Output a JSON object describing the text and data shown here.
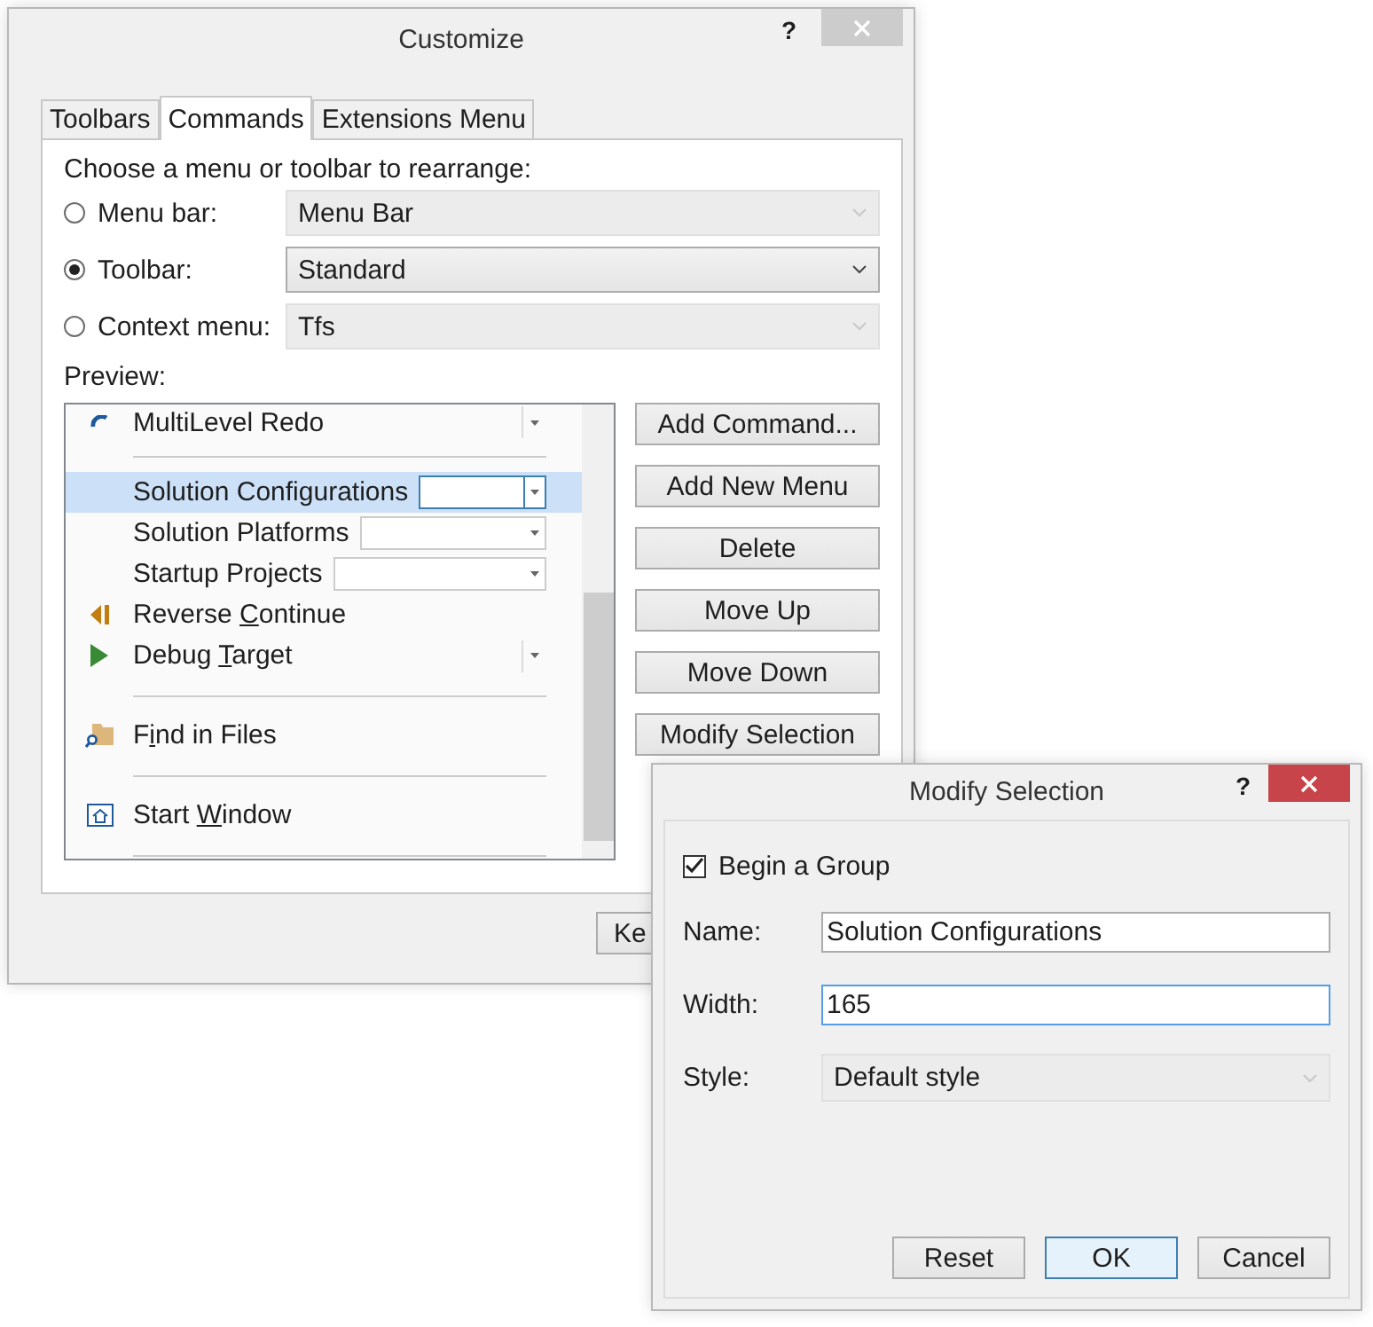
{
  "customize": {
    "title": "Customize",
    "help": "?",
    "tabs": [
      {
        "label": "Toolbars",
        "selected": false
      },
      {
        "label": "Commands",
        "selected": true
      },
      {
        "label": "Extensions Menu",
        "selected": false
      }
    ],
    "prompt": "Choose a menu or toolbar to rearrange:",
    "targets": [
      {
        "label": "Menu bar:",
        "selected": false,
        "value": "Menu Bar",
        "disabled": true
      },
      {
        "label": "Toolbar:",
        "selected": true,
        "value": "Standard",
        "disabled": false
      },
      {
        "label": "Context menu:",
        "selected": false,
        "value": "Tfs",
        "disabled": true
      }
    ],
    "preview_label": "Preview:",
    "preview_items": [
      {
        "kind": "command",
        "before": "MultiLevel Redo",
        "selected": false,
        "dropdown": true
      },
      {
        "kind": "separator"
      },
      {
        "kind": "combo",
        "before": "Solution Configurations",
        "selected": true
      },
      {
        "kind": "combo",
        "before": "Solution Platforms",
        "selected": false
      },
      {
        "kind": "combo",
        "before": "Startup Projects",
        "selected": false
      },
      {
        "kind": "command",
        "before": "Reverse ",
        "key": "C",
        "after": "ontinue",
        "selected": false,
        "dropdown": false
      },
      {
        "kind": "command",
        "before": "Debug ",
        "key": "T",
        "after": "arget",
        "selected": false,
        "dropdown": true
      },
      {
        "kind": "separator"
      },
      {
        "kind": "command",
        "before": "F",
        "key": "i",
        "after": "nd in Files",
        "selected": false,
        "dropdown": false
      },
      {
        "kind": "separator"
      },
      {
        "kind": "command",
        "before": "Start ",
        "key": "W",
        "after": "indow",
        "selected": false,
        "dropdown": false
      },
      {
        "kind": "separator"
      }
    ],
    "buttons": [
      "Add Command...",
      "Add New Menu",
      "Delete",
      "Move Up",
      "Move Down",
      "Modify Selection"
    ],
    "keyboard_button": "Ke"
  },
  "modify_selection": {
    "title": "Modify Selection",
    "help": "?",
    "begin_group": {
      "label": "Begin a Group",
      "checked": true
    },
    "fields": [
      {
        "kind": "text",
        "label": "Name:",
        "value": "Solution Configurations",
        "focused": false
      },
      {
        "kind": "text",
        "label": "Width:",
        "value": "165",
        "focused": true
      },
      {
        "kind": "combo",
        "label": "Style:",
        "value": "Default style"
      }
    ],
    "buttons": [
      {
        "label": "Reset",
        "default": false
      },
      {
        "label": "OK",
        "default": true
      },
      {
        "label": "Cancel",
        "default": false
      }
    ]
  }
}
